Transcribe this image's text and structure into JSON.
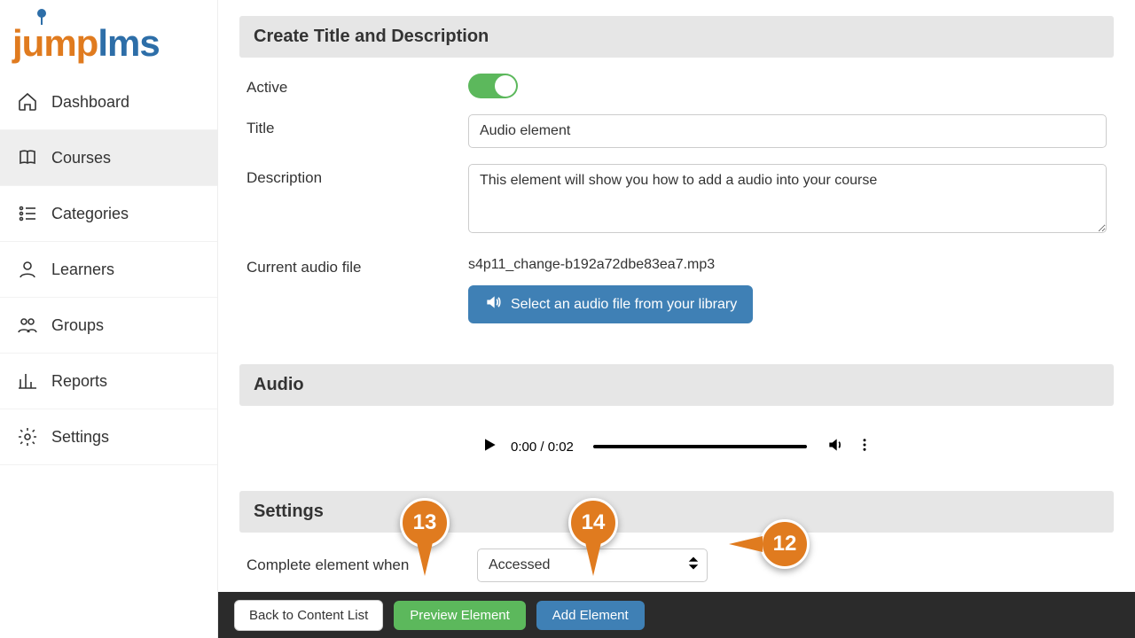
{
  "brand": {
    "word1": "jump",
    "word2": "lms"
  },
  "sidebar": {
    "items": [
      {
        "label": "Dashboard"
      },
      {
        "label": "Courses"
      },
      {
        "label": "Categories"
      },
      {
        "label": "Learners"
      },
      {
        "label": "Groups"
      },
      {
        "label": "Reports"
      },
      {
        "label": "Settings"
      }
    ]
  },
  "sections": {
    "create": {
      "title": "Create Title and Description",
      "active_label": "Active",
      "title_label": "Title",
      "title_value": "Audio element",
      "desc_label": "Description",
      "desc_value": "This element will show you how to add a audio into your course",
      "file_label": "Current audio file",
      "file_value": "s4p11_change-b192a72dbe83ea7.mp3",
      "select_file_btn": "Select an audio file from your library"
    },
    "audio": {
      "title": "Audio",
      "time_text": "0:00 / 0:02"
    },
    "settings": {
      "title": "Settings",
      "complete_label": "Complete element when",
      "select_value": "Accessed"
    }
  },
  "bottombar": {
    "back": "Back to Content List",
    "preview": "Preview Element",
    "add": "Add Element"
  },
  "callouts": {
    "c12": "12",
    "c13": "13",
    "c14": "14"
  }
}
